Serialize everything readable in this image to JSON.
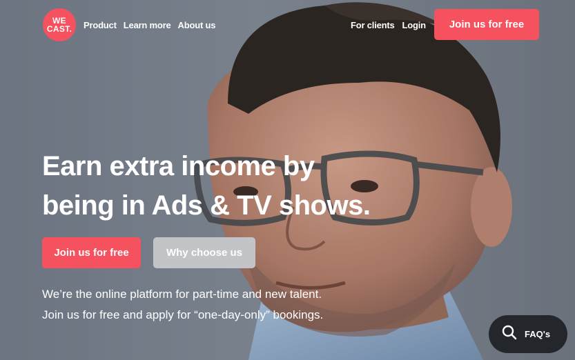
{
  "brand": {
    "logo_line1": "WE",
    "logo_line2": "CAST."
  },
  "nav": {
    "left": [
      "Product",
      "Learn more",
      "About us"
    ],
    "right": [
      "For clients",
      "Login"
    ],
    "cta": "Join us for free"
  },
  "hero": {
    "headline_line1": "Earn extra income by",
    "headline_line2": "being in Ads & TV shows.",
    "primary_button": "Join us for free",
    "secondary_button": "Why choose us",
    "tagline_line1": "We’re the online platform for part-time and new talent.",
    "tagline_line2": "Join us for free and apply for  “one-day-only” bookings."
  },
  "faq": {
    "label": "FAQ's",
    "icon": "search-icon"
  },
  "colors": {
    "accent": "#f5515f",
    "secondary_button": "#c2c4c8",
    "faq_bg": "#23272c"
  }
}
